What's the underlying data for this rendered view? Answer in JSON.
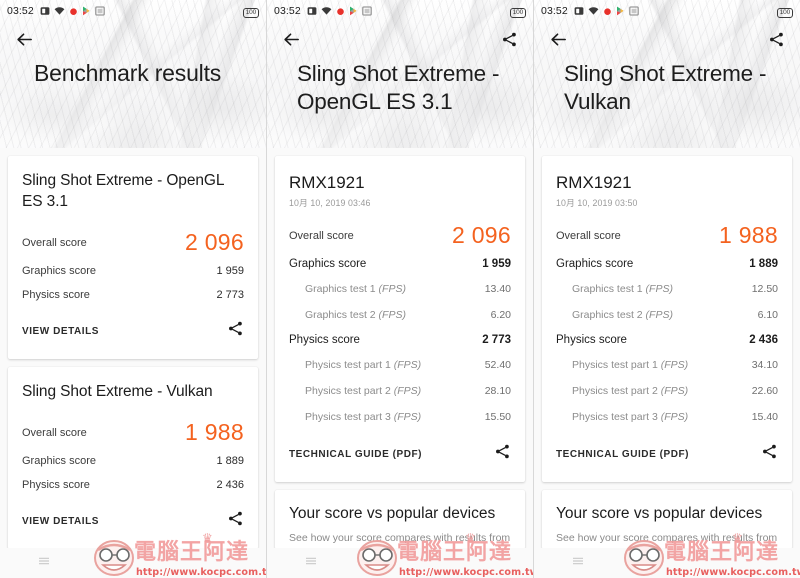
{
  "status_bar": {
    "time": "03:52",
    "battery": "100",
    "icons": [
      "screenshot-icon",
      "wifi-icon",
      "record-icon",
      "play-store-icon",
      "app-icon"
    ]
  },
  "labels": {
    "overall_score": "Overall score",
    "graphics_score": "Graphics score",
    "physics_score": "Physics score",
    "graphics_test_1": "Graphics test 1",
    "graphics_test_2": "Graphics test 2",
    "physics_test_1": "Physics test part 1",
    "physics_test_2": "Physics test part 2",
    "physics_test_3": "Physics test part 3",
    "fps_unit": "(FPS)",
    "view_details": "VIEW DETAILS",
    "technical_guide": "TECHNICAL GUIDE (PDF)"
  },
  "colors": {
    "accent": "#f4621f",
    "background": "#fafafa",
    "card": "#ffffff",
    "watermark_text": "#f29d9d",
    "watermark_url": "#e8605f"
  },
  "comparison": {
    "title": "Your score vs popular devices",
    "subtitle": "See how your score compares with results from"
  },
  "watermark": {
    "text": "電腦王阿達",
    "url": "http://www.kocpc.com.tw"
  },
  "panels": [
    {
      "hero_title": "Benchmark results",
      "has_share_in_appbar": false,
      "cards": [
        {
          "title": "Sling Shot Extreme - OpenGL ES 3.1",
          "overall": "2 096",
          "graphics": "1 959",
          "physics": "2 773",
          "action": "VIEW DETAILS"
        },
        {
          "title": "Sling Shot Extreme - Vulkan",
          "overall": "1 988",
          "graphics": "1 889",
          "physics": "2 436",
          "action": "VIEW DETAILS"
        }
      ]
    },
    {
      "hero_title": "Sling Shot Extreme - OpenGL ES 3.1",
      "has_share_in_appbar": true,
      "device": "RMX1921",
      "date": "10月 10, 2019 03:46",
      "overall": "2 096",
      "graphics": "1 959",
      "physics": "2 773",
      "graphics_test_1": "13.40",
      "graphics_test_2": "6.20",
      "physics_test_1": "52.40",
      "physics_test_2": "28.10",
      "physics_test_3": "15.50",
      "action": "TECHNICAL GUIDE (PDF)"
    },
    {
      "hero_title": "Sling Shot Extreme - Vulkan",
      "has_share_in_appbar": true,
      "device": "RMX1921",
      "date": "10月 10, 2019 03:50",
      "overall": "1 988",
      "graphics": "1 889",
      "physics": "2 436",
      "graphics_test_1": "12.50",
      "graphics_test_2": "6.10",
      "physics_test_1": "34.10",
      "physics_test_2": "22.60",
      "physics_test_3": "15.40",
      "action": "TECHNICAL GUIDE (PDF)"
    }
  ]
}
